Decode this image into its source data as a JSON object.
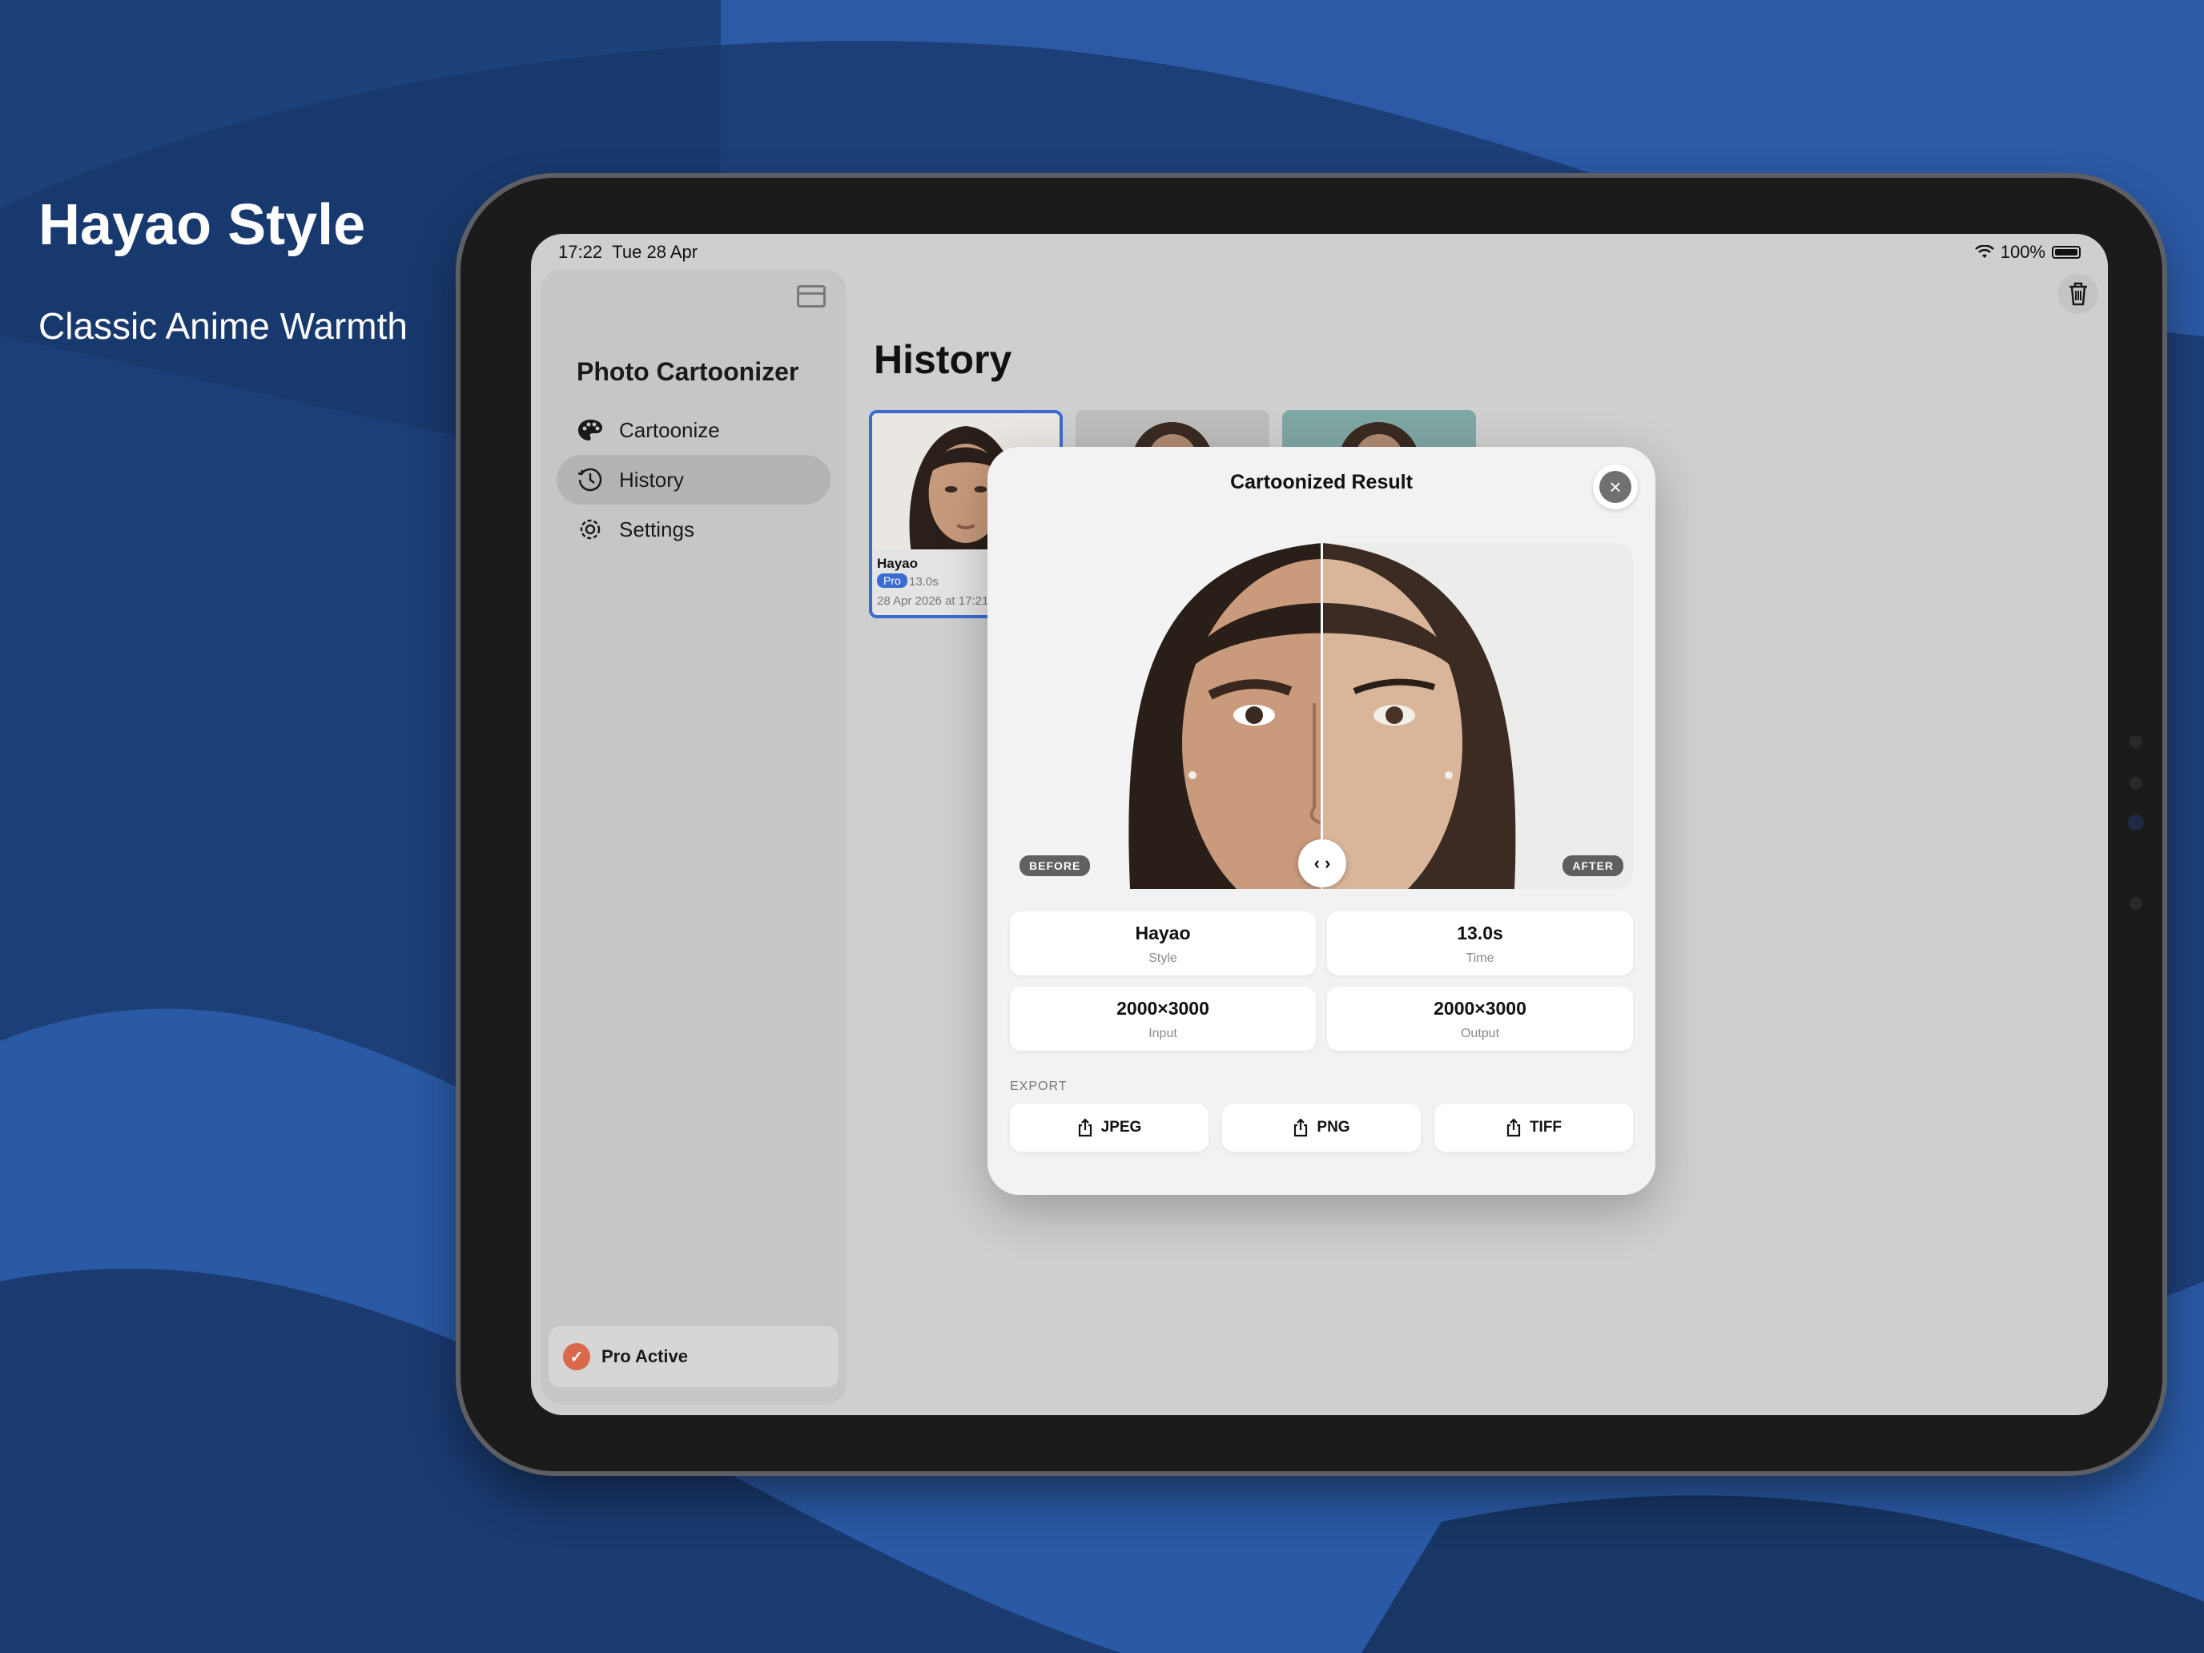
{
  "promo": {
    "title": "Hayao Style",
    "subtitle": "Classic Anime Warmth"
  },
  "status_bar": {
    "time": "17:22",
    "date": "Tue 28 Apr",
    "battery": "100%"
  },
  "sidebar": {
    "app_title": "Photo Cartoonizer",
    "items": [
      {
        "label": "Cartoonize",
        "icon": "palette-icon",
        "active": false
      },
      {
        "label": "History",
        "icon": "clock-history-icon",
        "active": true
      },
      {
        "label": "Settings",
        "icon": "gear-icon",
        "active": false
      }
    ],
    "pro_status": "Pro Active"
  },
  "main": {
    "title": "History",
    "history_items": [
      {
        "style": "Hayao",
        "badge": "Pro",
        "time": "13.0s",
        "date": "28 Apr 2026 at 17:21"
      }
    ]
  },
  "modal": {
    "title": "Cartoonized Result",
    "before_label": "BEFORE",
    "after_label": "AFTER",
    "handle_glyph": "‹ ›",
    "info": [
      {
        "value": "Hayao",
        "label": "Style"
      },
      {
        "value": "13.0s",
        "label": "Time"
      },
      {
        "value": "2000×3000",
        "label": "Input"
      },
      {
        "value": "2000×3000",
        "label": "Output"
      }
    ],
    "export_heading": "EXPORT",
    "export_buttons": [
      "JPEG",
      "PNG",
      "TIFF"
    ]
  },
  "colors": {
    "background": "#1d3f78",
    "accent": "#3a6bd1",
    "pro_badge": "#d9694a"
  }
}
